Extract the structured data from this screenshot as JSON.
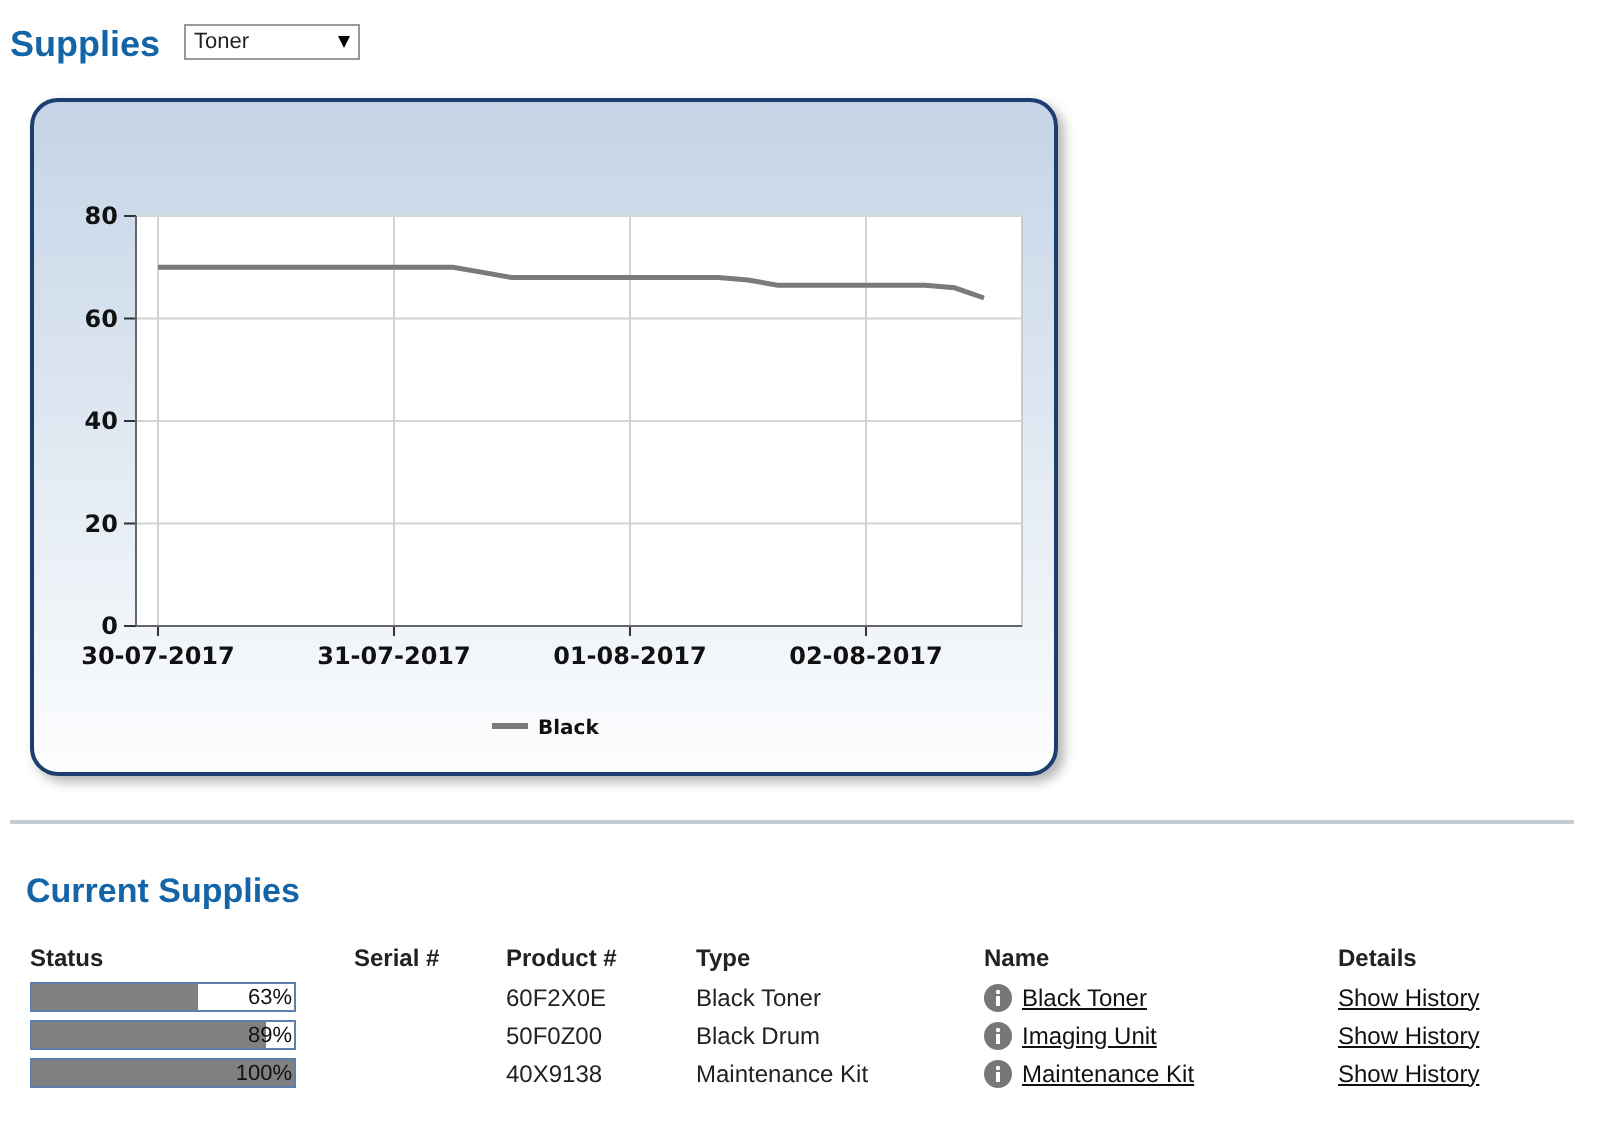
{
  "title": "Supplies",
  "supply_select": {
    "value": "Toner"
  },
  "history_chart": {
    "chart_data": {
      "type": "line",
      "categories": [
        "30-07-2017",
        null,
        null,
        null,
        null,
        null,
        null,
        null,
        "31-07-2017",
        null,
        null,
        null,
        null,
        null,
        null,
        null,
        "01-08-2017",
        null,
        null,
        null,
        null,
        null,
        null,
        null,
        "02-08-2017",
        null,
        null,
        null,
        null
      ],
      "series": [
        {
          "name": "Black",
          "color": "#7a7a7a",
          "values": [
            70,
            70,
            70,
            70,
            70,
            70,
            70,
            70,
            70,
            70,
            70,
            69,
            68,
            68,
            68,
            68,
            68,
            68,
            68,
            68,
            67.5,
            66.5,
            66.5,
            66.5,
            66.5,
            66.5,
            66.5,
            66,
            64
          ]
        }
      ],
      "ylim": [
        0,
        80
      ],
      "yticks": [
        0,
        20,
        40,
        60,
        80
      ],
      "grid": true
    }
  },
  "current_supplies": {
    "title": "Current Supplies",
    "columns": [
      "Status",
      "Serial #",
      "Product #",
      "Type",
      "Name",
      "Details"
    ],
    "rows": [
      {
        "level": 0.63,
        "percent": "63%",
        "product": "60F2X0E",
        "type": "Black Toner",
        "name": "Black Toner",
        "details": "Show History"
      },
      {
        "level": 0.89,
        "percent": "89%",
        "product": "50F0Z00",
        "type": "Black Drum",
        "name": "Imaging Unit",
        "details": "Show History"
      },
      {
        "level": 1,
        "percent": "100%",
        "product": "40X9138",
        "type": "Maintenance Kit",
        "name": "Maintenance Kit",
        "details": "Show History"
      }
    ]
  }
}
